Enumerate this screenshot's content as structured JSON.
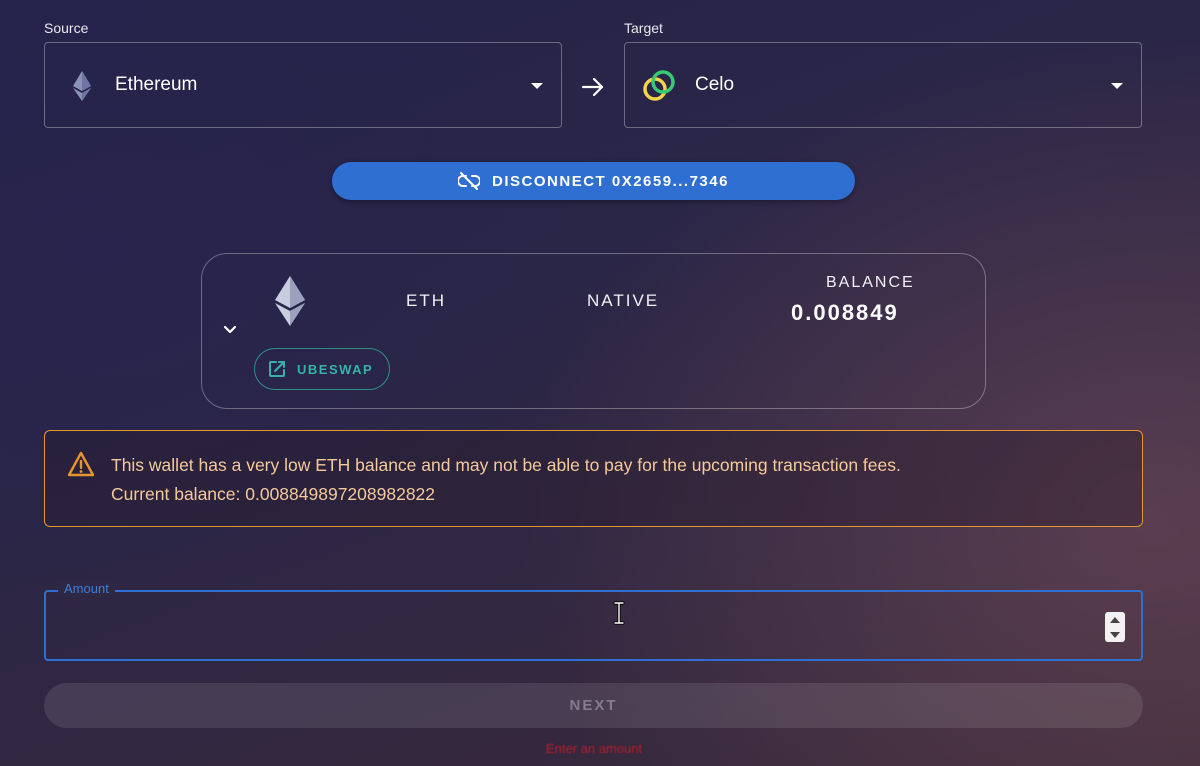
{
  "source": {
    "label": "Source",
    "chain": "Ethereum",
    "icon": "ethereum-icon"
  },
  "target": {
    "label": "Target",
    "chain": "Celo",
    "icon": "celo-icon"
  },
  "disconnect_button": {
    "label": "DISCONNECT 0X2659...7346",
    "icon": "unlink-icon"
  },
  "token_card": {
    "symbol": "ETH",
    "type": "NATIVE",
    "balance_label": "BALANCE",
    "balance_value": "0.008849",
    "swap_button": "UBESWAP",
    "swap_icon": "open-in-new-icon"
  },
  "warning": {
    "line1": "This wallet has a very low ETH balance and may not be able to pay for the upcoming transaction fees.",
    "line2": "Current balance: 0.008849897208982822",
    "color": "#e79432"
  },
  "amount": {
    "label": "Amount",
    "value": ""
  },
  "next_button": {
    "label": "NEXT"
  },
  "error": {
    "text": "Enter an amount"
  },
  "colors": {
    "accent": "#2f6fd2",
    "teal": "#35b3a6",
    "warning": "#e79432",
    "error": "#b81c2e"
  }
}
